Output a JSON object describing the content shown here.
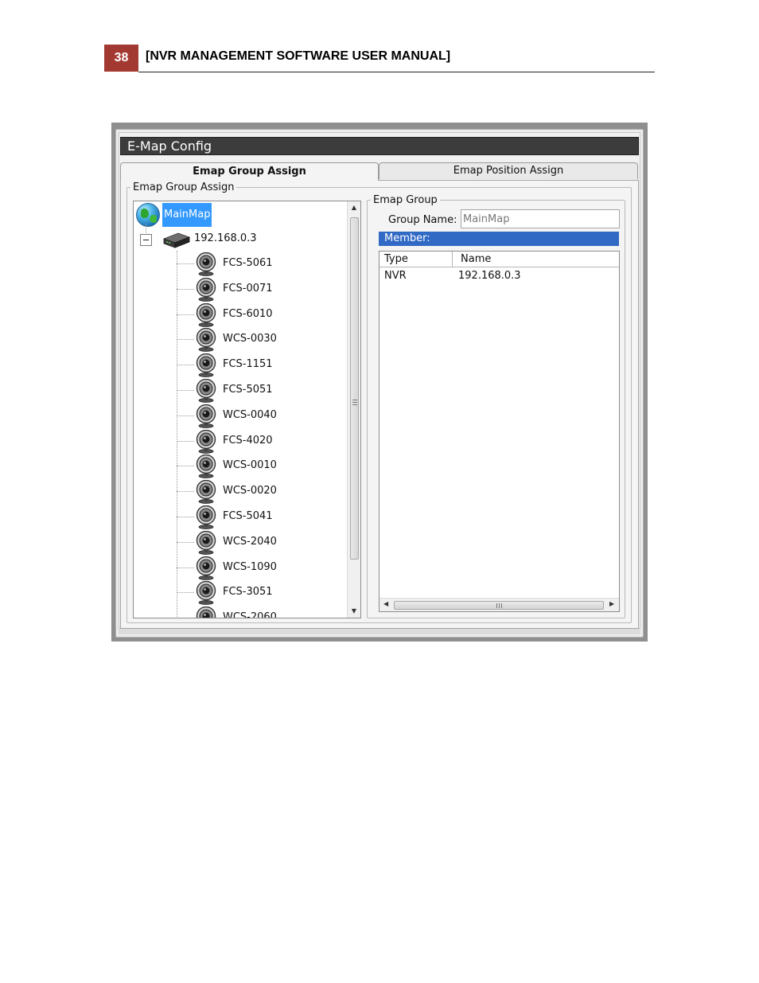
{
  "page": {
    "number": "38",
    "title": "[NVR MANAGEMENT SOFTWARE USER MANUAL]",
    "accent_color": "#a33a32"
  },
  "window": {
    "title": "E-Map Config",
    "tabs": [
      {
        "label": "Emap Group Assign",
        "active": true
      },
      {
        "label": "Emap Position Assign",
        "active": false
      }
    ]
  },
  "assign_panel": {
    "legend": "Emap Group Assign",
    "tree": {
      "root": {
        "label": "MainMap",
        "icon": "globe-icon",
        "selected": true
      },
      "nvr": {
        "label": "192.168.0.3",
        "icon": "nvr-icon",
        "expanded": true
      },
      "cameras": [
        {
          "label": "FCS-5061"
        },
        {
          "label": "FCS-0071"
        },
        {
          "label": "FCS-6010"
        },
        {
          "label": "WCS-0030"
        },
        {
          "label": "FCS-1151"
        },
        {
          "label": "FCS-5051"
        },
        {
          "label": "WCS-0040"
        },
        {
          "label": "FCS-4020"
        },
        {
          "label": "WCS-0010"
        },
        {
          "label": "WCS-0020"
        },
        {
          "label": "FCS-5041"
        },
        {
          "label": "WCS-2040"
        },
        {
          "label": "WCS-1090"
        },
        {
          "label": "FCS-3051"
        },
        {
          "label": "WCS-2060"
        }
      ]
    }
  },
  "emap_group": {
    "legend": "Emap Group",
    "group_name_label": "Group Name:",
    "group_name_value": "MainMap",
    "member_header": "Member:",
    "member_bar_color": "#316ac5",
    "columns": {
      "type": "Type",
      "name": "Name"
    },
    "members": [
      {
        "type": "NVR",
        "name": "192.168.0.3"
      }
    ],
    "scroll_grip": "III"
  }
}
